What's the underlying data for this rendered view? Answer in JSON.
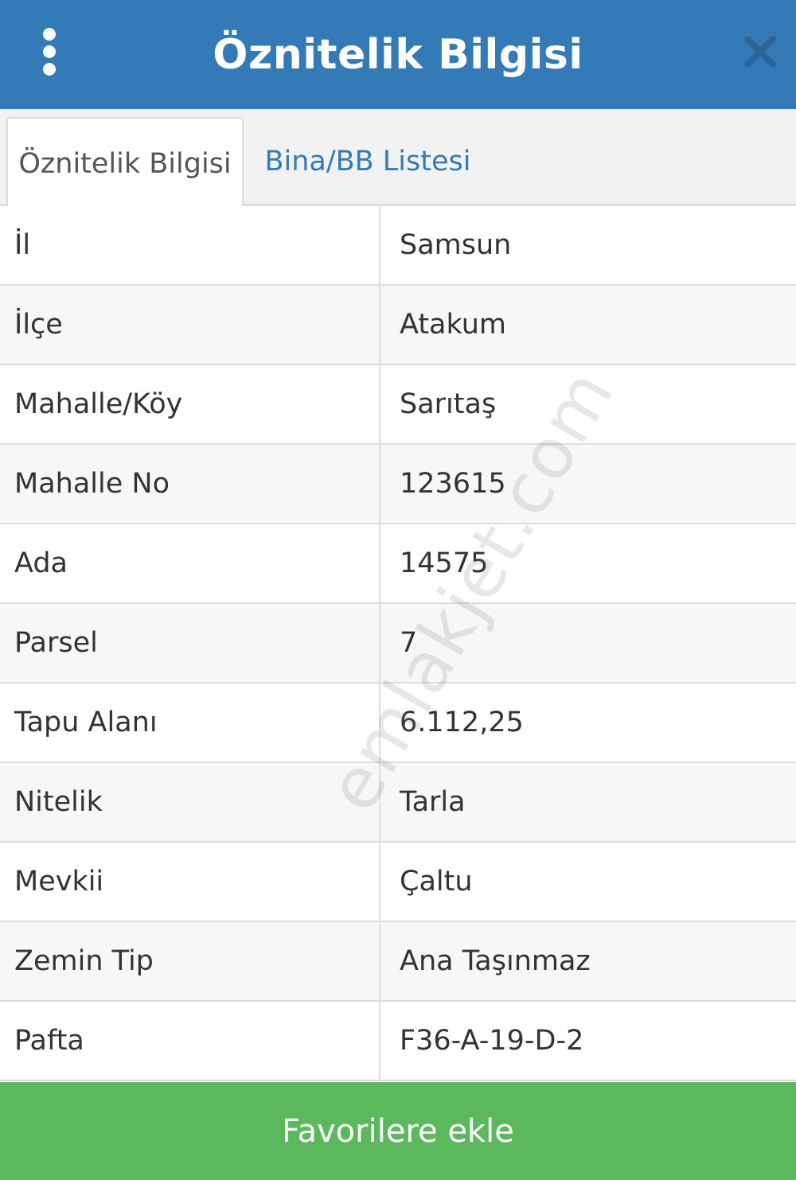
{
  "header": {
    "title": "Öznitelik Bilgisi",
    "menu_icon": "more-vertical-icon",
    "close_icon": "close-icon"
  },
  "tabs": [
    {
      "label": "Öznitelik Bilgisi",
      "active": true
    },
    {
      "label": "Bina/BB Listesi",
      "active": false
    }
  ],
  "attributes": [
    {
      "key": "İl",
      "value": "Samsun"
    },
    {
      "key": "İlçe",
      "value": "Atakum"
    },
    {
      "key": "Mahalle/Köy",
      "value": "Sarıtaş"
    },
    {
      "key": "Mahalle No",
      "value": "123615"
    },
    {
      "key": "Ada",
      "value": "14575"
    },
    {
      "key": "Parsel",
      "value": "7"
    },
    {
      "key": "Tapu Alanı",
      "value": "6.112,25"
    },
    {
      "key": "Nitelik",
      "value": "Tarla"
    },
    {
      "key": "Mevkii",
      "value": "Çaltu"
    },
    {
      "key": "Zemin Tip",
      "value": "Ana Taşınmaz"
    },
    {
      "key": "Pafta",
      "value": "F36-A-19-D-2"
    }
  ],
  "watermark": "emlakjet.com",
  "footer": {
    "favorite_label": "Favorilere ekle"
  },
  "colors": {
    "header_bg": "#337ab7",
    "link": "#337ab7",
    "footer_bg": "#5cb85c",
    "close_icon": "#2a6496"
  }
}
